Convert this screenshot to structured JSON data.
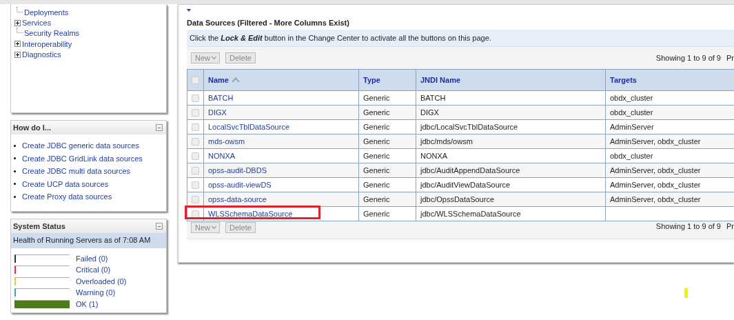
{
  "nav_tree": {
    "items": [
      {
        "label": "Deployments",
        "expandable": false
      },
      {
        "label": "Services",
        "expandable": true
      },
      {
        "label": "Security Realms",
        "expandable": false
      },
      {
        "label": "Interoperability",
        "expandable": true
      },
      {
        "label": "Diagnostics",
        "expandable": true
      }
    ]
  },
  "how_do_i": {
    "title": "How do I...",
    "links": [
      "Create JDBC generic data sources",
      "Create JDBC GridLink data sources",
      "Create JDBC multi data sources",
      "Create UCP data sources",
      "Create Proxy data sources"
    ]
  },
  "system_status": {
    "title": "System Status",
    "subtitle": "Health of Running Servers as of  7:08 AM",
    "items": [
      {
        "label": "Failed (0)",
        "level": 0,
        "color": "#333333"
      },
      {
        "label": "Critical (0)",
        "level": 0,
        "color": "#e03030"
      },
      {
        "label": "Overloaded (0)",
        "level": 0,
        "color": "#f0c040"
      },
      {
        "label": "Warning (0)",
        "level": 0,
        "color": "#40a0d0"
      },
      {
        "label": "OK (1)",
        "level": 1,
        "color": "#4e7a1e"
      }
    ]
  },
  "data_sources": {
    "title": "Data Sources (Filtered - More Columns Exist)",
    "info": "Click the *Lock & Edit* button in the Change Center to activate all the buttons on this page.",
    "top_toolbar": {
      "buttons": [
        {
          "label": "New",
          "dropdown": true,
          "disabled": true
        },
        {
          "label": "Delete",
          "dropdown": false,
          "disabled": true
        }
      ],
      "showing": "Showing 1 to 9 of 9",
      "pager_cut": "Pr"
    },
    "bottom_toolbar": {
      "buttons": [
        {
          "label": "New",
          "dropdown": true,
          "disabled": true
        },
        {
          "label": "Delete",
          "dropdown": false,
          "disabled": true
        }
      ],
      "showing": "Showing 1 to 9 of 9",
      "pager_cut": "Pr"
    },
    "table": {
      "select_all_checked": false,
      "columns": [
        {
          "label": "Name",
          "sorted": true
        },
        {
          "label": "Type",
          "sorted": false
        },
        {
          "label": "JNDI Name",
          "sorted": false
        },
        {
          "label": "Targets",
          "sorted": false
        }
      ],
      "rows": [
        {
          "cells": [
            "BATCH",
            "Generic",
            "BATCH",
            "obdx_cluster"
          ],
          "checked": false,
          "highlighted": false
        },
        {
          "cells": [
            "DIGX",
            "Generic",
            "DIGX",
            "obdx_cluster"
          ],
          "checked": false,
          "highlighted": false
        },
        {
          "cells": [
            "LocalSvcTblDataSource",
            "Generic",
            "jdbc/LocalSvcTblDataSource",
            "AdminServer"
          ],
          "checked": false,
          "highlighted": false
        },
        {
          "cells": [
            "mds-owsm",
            "Generic",
            "jdbc/mds/owsm",
            "AdminServer, obdx_cluster"
          ],
          "checked": false,
          "highlighted": false
        },
        {
          "cells": [
            "NONXA",
            "Generic",
            "NONXA",
            "obdx_cluster"
          ],
          "checked": false,
          "highlighted": false
        },
        {
          "cells": [
            "opss-audit-DBDS",
            "Generic",
            "jdbc/AuditAppendDataSource",
            "AdminServer, obdx_cluster"
          ],
          "checked": false,
          "highlighted": false
        },
        {
          "cells": [
            "opss-audit-viewDS",
            "Generic",
            "jdbc/AuditViewDataSource",
            "AdminServer, obdx_cluster"
          ],
          "checked": false,
          "highlighted": false
        },
        {
          "cells": [
            "opss-data-source",
            "Generic",
            "jdbc/OpssDataSource",
            "AdminServer, obdx_cluster"
          ],
          "checked": false,
          "highlighted": false
        },
        {
          "cells": [
            "WLSSchemaDataSource",
            "Generic",
            "jdbc/WLSSchemaDataSource",
            ""
          ],
          "checked": false,
          "highlighted": true
        }
      ]
    }
  }
}
